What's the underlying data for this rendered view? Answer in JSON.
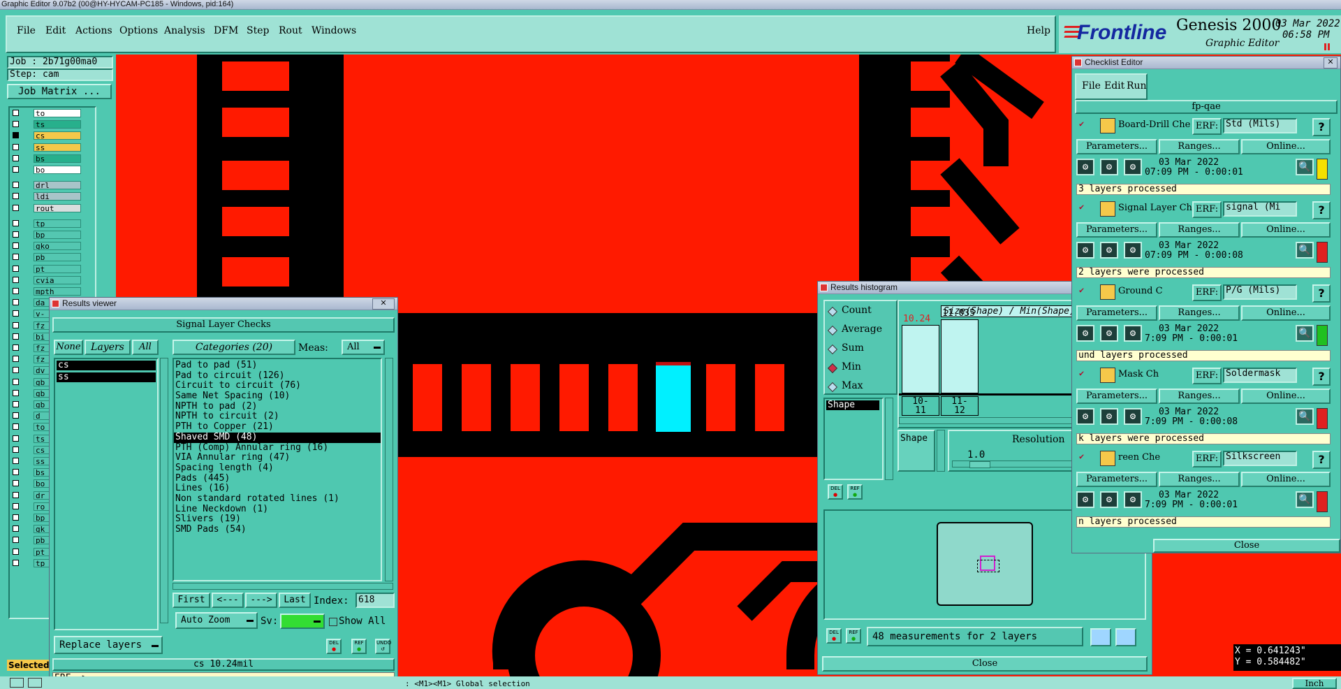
{
  "app": {
    "title": "Graphic Editor 9.07b2 (00@HY-HYCAM-PC185 - Windows, pid:164)",
    "menu": [
      "File",
      "Edit",
      "Actions",
      "Options",
      "Analysis",
      "DFM",
      "Step",
      "Rout",
      "Windows"
    ],
    "help": "Help",
    "brand": "Frontline",
    "product": "Genesis 2000",
    "subtitle": "Graphic Editor",
    "date": "03 Mar 2022",
    "time": "06:58 PM"
  },
  "left_panel": {
    "job": "Job : 2b71g00ma0",
    "step": "Step: cam",
    "job_matrix": "Job Matrix ...",
    "layers": [
      {
        "name": "to",
        "color": "#ffffff"
      },
      {
        "name": "ts",
        "color": "#27b08c"
      },
      {
        "name": "cs",
        "color": "#f5c84a"
      },
      {
        "name": "ss",
        "color": "#f5c84a"
      },
      {
        "name": "bs",
        "color": "#27b08c"
      },
      {
        "name": "bo",
        "color": "#ffffff"
      },
      {
        "name": "drl",
        "color": "#a9c4c9"
      },
      {
        "name": "ldi",
        "color": "#a9c4c9"
      },
      {
        "name": "rout",
        "color": "#d8dede"
      },
      {
        "name": "tp",
        "color": "#54c7b1"
      },
      {
        "name": "bp",
        "color": "#54c7b1"
      },
      {
        "name": "gko",
        "color": "#54c7b1"
      },
      {
        "name": "pb",
        "color": "#54c7b1"
      },
      {
        "name": "pt",
        "color": "#54c7b1"
      },
      {
        "name": "cvia",
        "color": "#54c7b1"
      },
      {
        "name": "mpth",
        "color": "#54c7b1"
      },
      {
        "name": "da",
        "color": "#54c7b1"
      },
      {
        "name": "v-",
        "color": "#54c7b1"
      },
      {
        "name": "fz",
        "color": "#54c7b1"
      },
      {
        "name": "bi",
        "color": "#54c7b1"
      },
      {
        "name": "fz",
        "color": "#54c7b1"
      },
      {
        "name": "fz",
        "color": "#54c7b1"
      },
      {
        "name": "dv",
        "color": "#54c7b1"
      },
      {
        "name": "gb",
        "color": "#54c7b1"
      },
      {
        "name": "gb",
        "color": "#54c7b1"
      },
      {
        "name": "gb",
        "color": "#54c7b1"
      },
      {
        "name": "d",
        "color": "#54c7b1"
      },
      {
        "name": "to",
        "color": "#54c7b1"
      },
      {
        "name": "ts",
        "color": "#54c7b1"
      },
      {
        "name": "cs",
        "color": "#54c7b1"
      },
      {
        "name": "ss",
        "color": "#54c7b1"
      },
      {
        "name": "bs",
        "color": "#54c7b1"
      },
      {
        "name": "bo",
        "color": "#54c7b1"
      },
      {
        "name": "dr",
        "color": "#54c7b1"
      },
      {
        "name": "ro",
        "color": "#54c7b1"
      },
      {
        "name": "bp",
        "color": "#54c7b1"
      },
      {
        "name": "gk",
        "color": "#54c7b1"
      },
      {
        "name": "pb",
        "color": "#54c7b1"
      },
      {
        "name": "pt",
        "color": "#54c7b1"
      },
      {
        "name": "tp",
        "color": "#54c7b1"
      }
    ],
    "selected_label": "Selected"
  },
  "results_viewer": {
    "title": "Results viewer",
    "header": "Signal Layer Checks",
    "none": "None",
    "layers": "Layers",
    "all": "All",
    "layer_list": [
      "cs",
      "ss"
    ],
    "categories_label": "Categories (20)",
    "meas_label": "Meas:",
    "meas_value": "All",
    "categories": [
      "Pad to pad (51)",
      "Pad to circuit (126)",
      "Circuit to circuit (76)",
      "Same Net Spacing (10)",
      "NPTH to pad (2)",
      "NPTH to circuit (2)",
      "PTH to Copper (21)",
      "Shaved SMD (48)",
      "PTH (Comp) Annular ring (16)",
      "VIA Annular ring (47)",
      "Spacing length (4)",
      "Pads (445)",
      "Lines (16)",
      "Non standard rotated lines (1)",
      "Line Neckdown (1)",
      "Slivers (19)",
      "SMD Pads (54)"
    ],
    "selected_category": "Shaved SMD (48)",
    "first": "First",
    "prev": "<---",
    "next": "--->",
    "last": "Last",
    "index_label": "Index:",
    "index_value": "618",
    "auto_zoom": "Auto Zoom",
    "sv_label": "Sv:",
    "show_all": "Show All",
    "replace_layers": "Replace layers",
    "status": "cs 10.24mil",
    "erf": "ERF-->",
    "del": "DEL",
    "ref": "REF",
    "undo": "UNDO"
  },
  "histogram": {
    "title": "Results histogram",
    "options": [
      "Count",
      "Average",
      "Sum",
      "Min",
      "Max"
    ],
    "selected_option": "Min",
    "shape_list": [
      "Shape"
    ],
    "chart_title": "Size(Shape) / Min(Shape)",
    "bars": [
      {
        "label_top": "10-",
        "label_bot": "11",
        "value": 10.24,
        "value_text": "10.24"
      },
      {
        "label_top": "11-",
        "label_bot": "12",
        "value": 11.035,
        "value_text": "11.035"
      }
    ],
    "shape_btn": "Shape",
    "resolution_label": "Resolution",
    "resolution_value": "1.0",
    "footer": "48 measurements for 2 layers",
    "close": "Close",
    "del": "DEL",
    "ref": "REF"
  },
  "checklist": {
    "title": "Checklist Editor",
    "menu": [
      "File",
      "Edit",
      "Run"
    ],
    "name": "fp-qae",
    "checks": [
      {
        "name": "Board-Drill Che",
        "erf": "Std (Mils)",
        "date": "03 Mar 2022",
        "time": "07:09 PM - 0:00:01",
        "status": "3 layers processed",
        "flag": "#f5e000"
      },
      {
        "name": "Signal Layer Ch",
        "erf": "signal (Mi",
        "date": "03 Mar 2022",
        "time": "07:09 PM - 0:00:08",
        "status": "2 layers were processed",
        "flag": "#e02020"
      },
      {
        "name": "Ground C",
        "erf": "P/G (Mils)",
        "date": "03 Mar 2022",
        "time": "7:09 PM - 0:00:01",
        "status": "und layers processed",
        "flag": "#20c020"
      },
      {
        "name": "Mask Ch",
        "erf": "Soldermask",
        "date": "03 Mar 2022",
        "time": "7:09 PM - 0:00:08",
        "status": "k layers were processed",
        "flag": "#e02020"
      },
      {
        "name": "reen Che",
        "erf": "Silkscreen",
        "date": "03 Mar 2022",
        "time": "7:09 PM - 0:00:01",
        "status": "n layers processed",
        "flag": "#e02020"
      }
    ],
    "erf_label": "ERF:",
    "parameters": "Parameters...",
    "ranges": "Ranges...",
    "online": "Online...",
    "close": "Close"
  },
  "coords": {
    "x": "X = 0.641243\"",
    "y": "Y = 0.584482\""
  },
  "bottom": {
    "prompt": ": <M1><M1> Global selection",
    "units": "Inch"
  }
}
